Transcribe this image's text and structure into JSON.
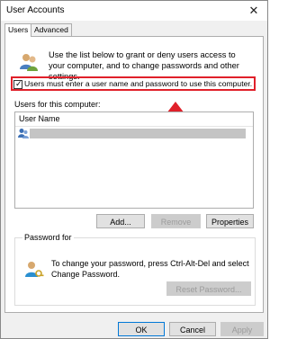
{
  "window": {
    "title": "User Accounts",
    "close_glyph": "✕"
  },
  "tabs": [
    {
      "label": "Users",
      "active": true
    },
    {
      "label": "Advanced",
      "active": false
    }
  ],
  "intro_text": "Use the list below to grant or deny users access to your computer, and to change passwords and other settings.",
  "require_login": {
    "label": "Users must enter a user name and password to use this computer.",
    "checked": true,
    "check_glyph": "✓"
  },
  "users_list": {
    "caption": "Users for this computer:",
    "column_header": "User Name",
    "rows": [
      {
        "name": "",
        "icon": "user-icon"
      }
    ]
  },
  "buttons": {
    "add": "Add...",
    "remove": "Remove",
    "properties": "Properties"
  },
  "password_group": {
    "title": "Password for",
    "text": "To change your password, press Ctrl-Alt-Del and select Change Password.",
    "reset_button": "Reset Password..."
  },
  "footer": {
    "ok": "OK",
    "cancel": "Cancel",
    "apply": "Apply"
  },
  "colors": {
    "highlight_box": "#e0202a",
    "arrow": "#e0202a"
  }
}
